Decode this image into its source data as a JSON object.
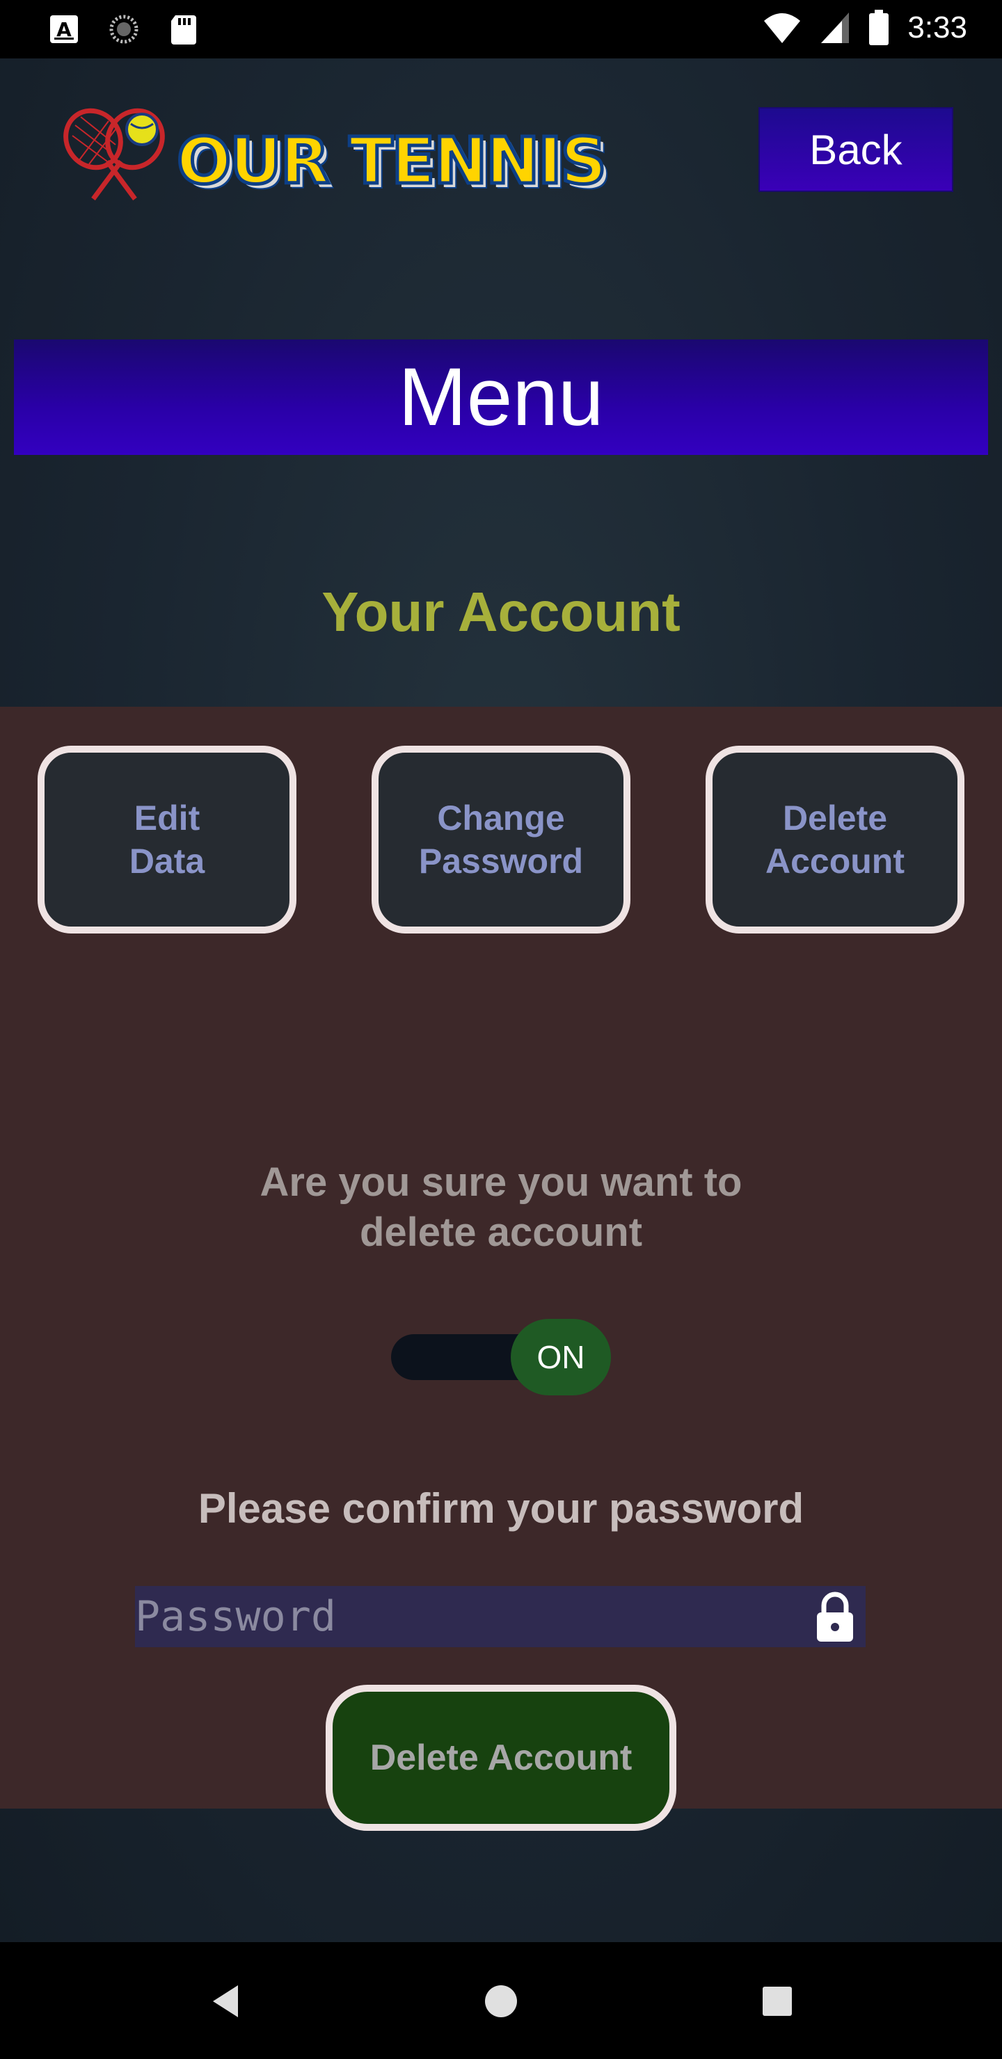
{
  "status_bar": {
    "time": "3:33",
    "icons_left": [
      "font-app-icon",
      "loading-icon",
      "sd-card-icon"
    ],
    "icons_right": [
      "wifi-icon",
      "cellular-signal-icon",
      "battery-icon"
    ]
  },
  "header": {
    "logo_text": "OUR TENNIS",
    "back_label": "Back"
  },
  "menu": {
    "label": "Menu"
  },
  "account": {
    "title": "Your Account",
    "tiles": [
      {
        "line1": "Edit",
        "line2": "Data"
      },
      {
        "line1": "Change",
        "line2": "Password"
      },
      {
        "line1": "Delete",
        "line2": "Account"
      }
    ],
    "confirm_line1": "Are you sure you want to",
    "confirm_line2": "delete account",
    "toggle_label": "ON",
    "password_label": "Please confirm your password",
    "password_placeholder": "Password",
    "delete_button_label": "Delete Account"
  },
  "colors": {
    "accent_title": "#a7b03b",
    "menu_bar": "#2a00a8",
    "panel": "#3d2829",
    "toggle_on": "#1f5a24",
    "delete_button": "#17420f"
  },
  "nav": [
    "back-nav-icon",
    "home-nav-icon",
    "recents-nav-icon"
  ]
}
